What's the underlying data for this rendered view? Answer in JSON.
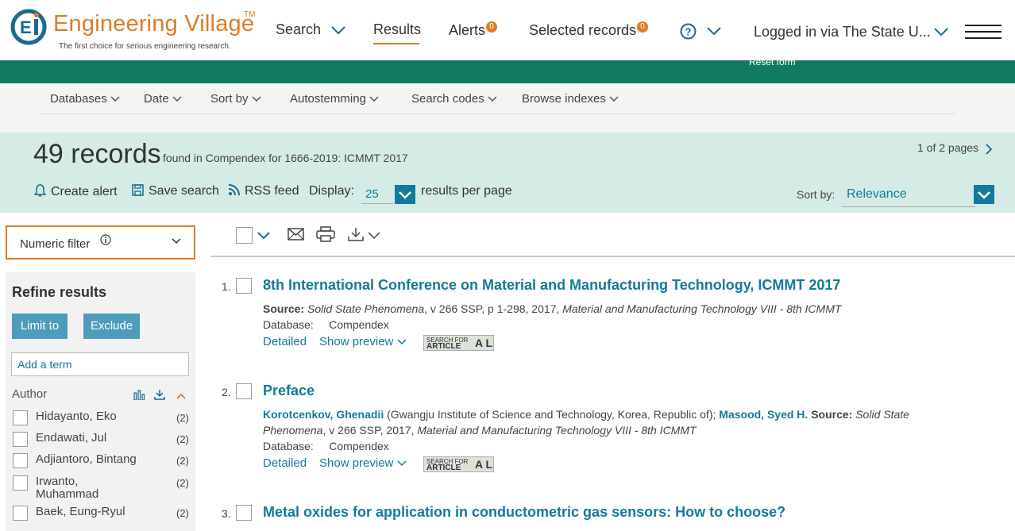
{
  "header": {
    "logo_text": "Engineering Village",
    "logo_tm": "TM",
    "tagline": "The first choice for serious engineering research.",
    "nav": {
      "search": "Search",
      "results": "Results",
      "alerts": "Alerts",
      "alerts_count": "0",
      "selected": "Selected records",
      "selected_count": "0"
    },
    "user": "Logged in via The State U...",
    "reset_form": "Reset form"
  },
  "options": {
    "databases": "Databases",
    "date": "Date",
    "sort_by": "Sort by",
    "autostemming": "Autostemming",
    "search_codes": "Search codes",
    "browse_indexes": "Browse indexes"
  },
  "records": {
    "count": "49 records",
    "found_in": "found in Compendex for 1666-2019: ICMMT 2017",
    "pages": "1 of 2 pages",
    "create_alert": "Create alert",
    "save_search": "Save search",
    "rss_feed": "RSS feed",
    "display_label": "Display:",
    "display_value": "25",
    "per_page": "results per page",
    "sort_label": "Sort by:",
    "sort_value": "Relevance"
  },
  "left": {
    "numeric_filter": "Numeric filter",
    "refine_title": "Refine results",
    "limit_to": "Limit to",
    "exclude": "Exclude",
    "add_term_placeholder": "Add a term",
    "author_heading": "Author",
    "authors": [
      {
        "name": "Hidayanto, Eko",
        "count": "(2)"
      },
      {
        "name": "Endawati, Jul",
        "count": "(2)"
      },
      {
        "name": "Adjiantoro, Bintang",
        "count": "(2)"
      },
      {
        "name_line1": "Irwanto,",
        "name_line2": "Muhammad",
        "count": "(2)"
      },
      {
        "name": "Baek, Eung-Ryul",
        "count": "(2)"
      }
    ]
  },
  "results": [
    {
      "num": "1.",
      "title": "8th International Conference on Material and Manufacturing Technology, ICMMT 2017",
      "source_label": "Source:",
      "source": "Solid State Phenomena",
      "source_rest": ", v 266 SSP, p 1-298, 2017, ",
      "source_conf": "Material and Manufacturing Technology VIII - 8th ICMMT",
      "db_label": "Database:",
      "db": "Compendex",
      "detailed": "Detailed",
      "preview": "Show preview"
    },
    {
      "num": "2.",
      "title": "Preface",
      "author1": "Korotcenkov, Ghenadii",
      "affil": " (Gwangju Institute of Science and Technology, Korea, Republic of); ",
      "author2": "Masood, Syed H.",
      "source_label": " Source:",
      "source": " Solid State",
      "source2": "Phenomena",
      "source_rest": ", v 266 SSP, 2017, ",
      "source_conf": "Material and Manufacturing Technology VIII - 8th ICMMT",
      "db_label": "Database:",
      "db": "Compendex",
      "detailed": "Detailed",
      "preview": "Show preview"
    },
    {
      "num": "3.",
      "title": "Metal oxides for application in conductometric gas sensors: How to choose?"
    }
  ],
  "sfa": {
    "line1": "SEARCH FOR",
    "line2": "ARTICLE",
    "line3": "A L"
  },
  "colors": {
    "accent": "#e07b27",
    "teal": "#127a62",
    "link": "#127a9b",
    "band": "#d5ebe6"
  }
}
